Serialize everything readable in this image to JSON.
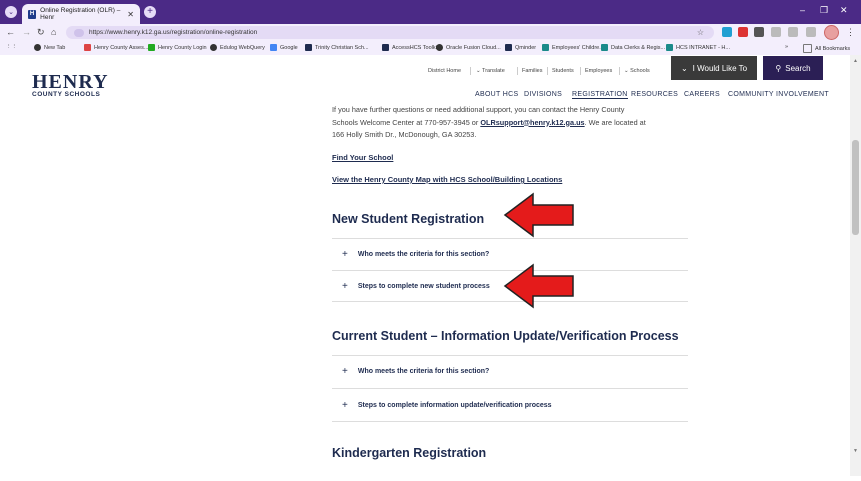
{
  "browser": {
    "tab_title": "Online Registration (OLR) – Henr",
    "tab_favicon": "H",
    "url": "https://www.henry.k12.ga.us/registration/online-registration",
    "bookmarks": [
      "New Tab",
      "Henry County Asses...",
      "Henry County Login",
      "Edulog WebQuery",
      "Google",
      "Trinity Christian Sch...",
      "AccessHCS Toolkit",
      "Oracle Fusion Cloud...",
      "Qminder",
      "Employees' Childre...",
      "Data Clerks & Regis...",
      "HCS INTRANET - H..."
    ],
    "all_bookmarks_label": "All Bookmarks"
  },
  "site": {
    "logo_line1": "HENRY",
    "logo_line2": "COUNTY SCHOOLS",
    "utility_links": [
      "District Home",
      "Translate",
      "Families",
      "Students",
      "Employees",
      "Schools"
    ],
    "cta_label": "I Would Like To",
    "search_label": "Search",
    "nav": [
      "ABOUT HCS",
      "DIVISIONS",
      "REGISTRATION",
      "RESOURCES",
      "CAREERS",
      "COMMUNITY INVOLVEMENT"
    ]
  },
  "content": {
    "intro_line1": "If you have further questions or need additional support, you can contact the Henry County",
    "intro_line2_pre": "Schools Welcome Center at 770-957-3945 or ",
    "intro_email": "OLRsupport@henry.k12.ga.us",
    "intro_line2_post": ". We are located at",
    "intro_line3": "166 Holly Smith Dr., McDonough, GA 30253.",
    "link_find_school": "Find Your School",
    "link_map": "View the Henry County Map with HCS School/Building Locations",
    "section_new": "New Student Registration",
    "new_acc1": "Who meets the criteria for this section?",
    "new_acc2": "Steps to complete new student process",
    "section_current": "Current Student – Information Update/Verification Process",
    "cur_acc1": "Who meets the criteria for this section?",
    "cur_acc2": "Steps to complete information update/verification process",
    "section_kinder": "Kindergarten Registration"
  },
  "colors": {
    "browser_frame": "#4b2a86",
    "brand_navy": "#1e2b4f",
    "annotation_arrow": "#e41b1b"
  }
}
